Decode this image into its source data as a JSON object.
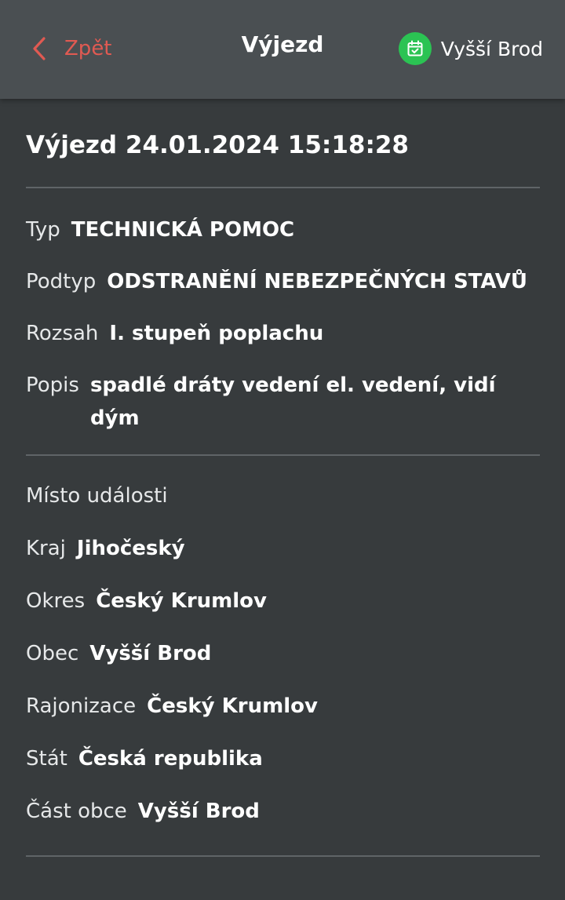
{
  "header": {
    "back_label": "Zpět",
    "title": "Výjezd",
    "unit_name": "Vyšší Brod",
    "icons": {
      "back": "chevron-left-icon",
      "unit": "calendar-check-icon"
    },
    "colors": {
      "accent": "#e05a52",
      "unit_badge": "#2bc353"
    }
  },
  "incident": {
    "heading": "Výjezd 24.01.2024 15:18:28",
    "details": [
      {
        "label": "Typ",
        "value": "TECHNICKÁ POMOC"
      },
      {
        "label": "Podtyp",
        "value": "ODSTRANĚNÍ NEBEZPEČNÝCH STAVŮ"
      },
      {
        "label": "Rozsah",
        "value": "I. stupeň poplachu"
      },
      {
        "label": "Popis",
        "value": "spadlé dráty vedení el. vedení, vidí dým"
      }
    ]
  },
  "location": {
    "section_label": "Místo události",
    "fields": [
      {
        "label": "Kraj",
        "value": "Jihočeský"
      },
      {
        "label": "Okres",
        "value": "Český Krumlov"
      },
      {
        "label": "Obec",
        "value": "Vyšší Brod"
      },
      {
        "label": "Rajonizace",
        "value": "Český Krumlov"
      },
      {
        "label": "Stát",
        "value": "Česká republika"
      },
      {
        "label": "Část obce",
        "value": "Vyšší Brod"
      }
    ]
  }
}
